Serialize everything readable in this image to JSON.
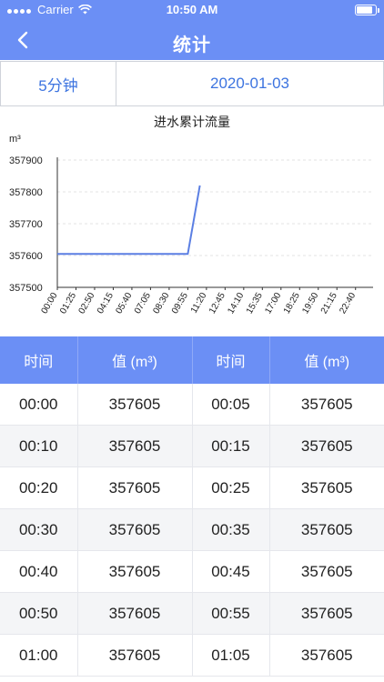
{
  "status_bar": {
    "carrier": "Carrier",
    "time": "10:50 AM",
    "battery_level": 0.95
  },
  "nav": {
    "title": "统计"
  },
  "selector": {
    "interval": "5分钟",
    "date": "2020-01-03"
  },
  "chart_data": {
    "type": "line",
    "title": "进水累计流量",
    "ylabel": "m³",
    "ylim": [
      357500,
      357900
    ],
    "y_ticks": [
      "357900",
      "357800",
      "357700",
      "357600",
      "357500"
    ],
    "x_ticks": [
      "00:00",
      "01:25",
      "02:50",
      "04:15",
      "05:40",
      "07:05",
      "08:30",
      "09:55",
      "11:20",
      "12:45",
      "14:10",
      "15:35",
      "17:00",
      "18:25",
      "19:50",
      "21:15",
      "22:40"
    ],
    "grid": "horizontal-dashed",
    "line_color": "#5b7fe3",
    "series": [
      {
        "x": [
          "00:00",
          "09:55",
          "10:50"
        ],
        "values": [
          357605,
          357605,
          357820
        ]
      }
    ]
  },
  "table": {
    "headers": [
      "时间",
      "值 (m³)",
      "时间",
      "值 (m³)"
    ],
    "rows": [
      [
        "00:00",
        "357605",
        "00:05",
        "357605"
      ],
      [
        "00:10",
        "357605",
        "00:15",
        "357605"
      ],
      [
        "00:20",
        "357605",
        "00:25",
        "357605"
      ],
      [
        "00:30",
        "357605",
        "00:35",
        "357605"
      ],
      [
        "00:40",
        "357605",
        "00:45",
        "357605"
      ],
      [
        "00:50",
        "357605",
        "00:55",
        "357605"
      ],
      [
        "01:00",
        "357605",
        "01:05",
        "357605"
      ]
    ]
  }
}
